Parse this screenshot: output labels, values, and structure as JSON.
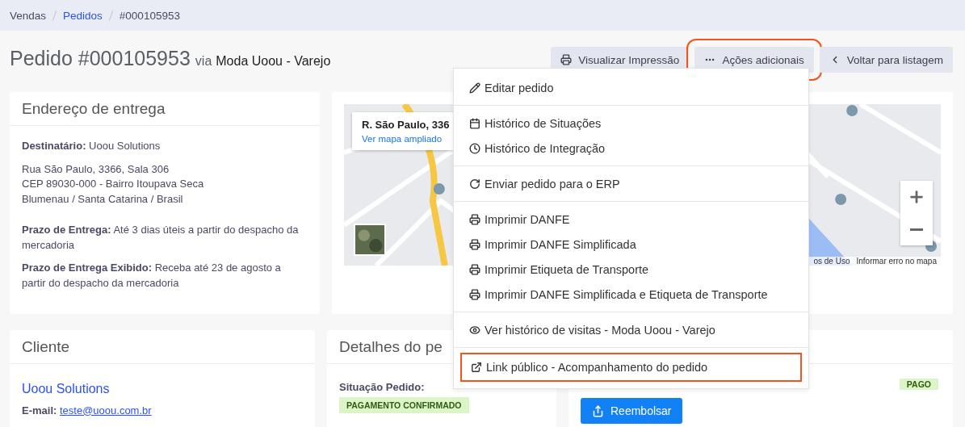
{
  "breadcrumb": [
    {
      "label": "Vendas",
      "link": false
    },
    {
      "label": "Pedidos",
      "link": true
    },
    {
      "label": "#000105953",
      "link": false
    }
  ],
  "header": {
    "title": "Pedido #000105953",
    "via": "via",
    "store": "Moda Uoou - Varejo"
  },
  "actions": [
    {
      "label": "Visualizar Impressão",
      "kind": "print",
      "highlighted": false
    },
    {
      "label": "Ações adicionais",
      "kind": "more",
      "highlighted": true
    },
    {
      "label": "Voltar para listagem",
      "kind": "back",
      "highlighted": false
    }
  ],
  "menu": [
    [
      {
        "label": "Editar pedido",
        "kind": "edit",
        "highlighted": false
      }
    ],
    [
      {
        "label": "Histórico de Situações",
        "kind": "calendar",
        "highlighted": false
      },
      {
        "label": "Histórico de Integração",
        "kind": "clock",
        "highlighted": false
      }
    ],
    [
      {
        "label": "Enviar pedido para o ERP",
        "kind": "refresh",
        "highlighted": false
      }
    ],
    [
      {
        "label": "Imprimir DANFE",
        "kind": "print",
        "highlighted": false
      },
      {
        "label": "Imprimir DANFE Simplificada",
        "kind": "print",
        "highlighted": false
      },
      {
        "label": "Imprimir Etiqueta de Transporte",
        "kind": "print",
        "highlighted": false
      },
      {
        "label": "Imprimir DANFE Simplificada e Etiqueta de Transporte",
        "kind": "print",
        "highlighted": false
      }
    ],
    [
      {
        "label": "Ver histórico de visitas - Moda Uoou - Varejo",
        "kind": "view",
        "highlighted": false
      }
    ],
    [
      {
        "label": "Link público - Acompanhamento do pedido",
        "kind": "link",
        "highlighted": true
      }
    ]
  ],
  "address": {
    "title": "Endereço de entrega",
    "recipient": {
      "label": "Destinatário:",
      "value": "Uoou Solutions"
    },
    "lines": [
      "Rua São Paulo, 3366, Sala 306",
      "CEP 89030-000 - Bairro Itoupava Seca",
      "Blumenau / Santa Catarina / Brasil"
    ],
    "deadline": {
      "label": "Prazo de Entrega:",
      "value": "Até 3 dias úteis a partir do despacho da mercadoria"
    },
    "shown_deadline": {
      "label": "Prazo de Entrega Exibido:",
      "value": "Receba até 23 de agosto a partir do despacho da mercadoria"
    }
  },
  "map": {
    "info_title": "R. São Paulo, 336",
    "info_link": "Ver mapa ampliado",
    "attribution": [
      "os de Uso",
      "Informar erro no mapa"
    ]
  },
  "client": {
    "title": "Cliente",
    "name": "Uoou Solutions",
    "email": {
      "label": "E-mail:",
      "value": "teste@uoou.com.br"
    }
  },
  "details": {
    "title": "Detalhes do pe",
    "status": {
      "label": "Situação Pedido:",
      "badge": "PAGAMENTO CONFIRMADO"
    }
  },
  "payment": {
    "badge": "PAGO",
    "button": "Reembolsar"
  }
}
